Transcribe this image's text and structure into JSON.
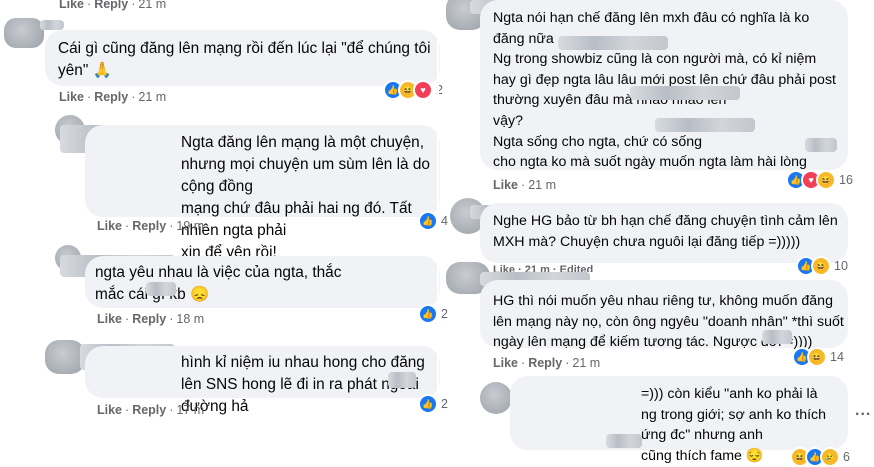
{
  "labels": {
    "like": "Like",
    "reply": "Reply",
    "dot": "·",
    "edited": "Edited",
    "more": "..."
  },
  "icons": {
    "like": "like-reaction-icon",
    "haha": "haha-reaction-icon",
    "love": "love-reaction-icon",
    "sad": "sad-reaction-icon"
  },
  "colors": {
    "bubble": "#f0f2f5",
    "meta": "#65676b",
    "like": "#1877f2",
    "love": "#f33e58",
    "haha": "#f7b928"
  },
  "left": [
    {
      "time": "21 m"
    },
    {
      "text": "Cái gì cũng đăng lên mạng rồi đến lúc lại \"để chúng tôi\nyên\" 🙏",
      "time": "21 m",
      "count": "2"
    },
    {
      "text": "Ngta đăng lên mạng là một chuyện,\nnhưng mọi chuyện um sùm lên là do cộng đồng\nmạng chứ đâu phải hai ng đó. Tất nhiên ngta phải\nxin để yên rồi!",
      "time": "19 m",
      "count": "4"
    },
    {
      "text": "ngta yêu nhau là việc của ngta, thắc\nmắc cái     gì kb 😞",
      "time": "18 m",
      "count": "2"
    },
    {
      "text": "hình kỉ niệm iu nhau hong cho đăng\nlên SNS hong lẽ đi in ra phát ngoài đường hả",
      "time": "17 m",
      "count": "2"
    }
  ],
  "right": [
    {
      "text": "Ngta nói hạn chế đăng lên mxh đâu có nghĩa là ko\nđăng nữa\nNg trong showbiz cũng là con người mà, có kỉ niệm\nhay gì đẹp ngta lâu lâu mới post lên chứ đâu phải post\nthường xuyên đâu mà                     nháo nhào lên\nvậy?\nNgta sống cho ngta, chứ                   có sống\ncho ngta ko mà suốt ngày muốn ngta làm hài lòng",
      "time": "21 m",
      "count": "16"
    },
    {
      "text": "Nghe HG bảo từ bh hạn chế đăng chuyện tình cảm lên\nMXH mà? Chuyện chưa nguôi lại đăng tiếp =)))))",
      "count": "10"
    },
    {
      "meta_text": "Like · 21 m · Edited",
      "text": "HG thì nói muốn yêu nhau riêng tư, không muốn đăng\nlên mạng này nọ, còn ông ngyêu \"doanh nhân\" *thì suốt\nngày lên mạng để kiếm tương tác. Ngược đời        =))))",
      "time": "21 m",
      "count": "14"
    },
    {
      "text": "=))) còn kiểu \"anh ko phải là\nng trong giới; sợ anh ko thích ứng đc\" nhưng anh\ncũng thích fame      😔",
      "count": "6"
    }
  ]
}
